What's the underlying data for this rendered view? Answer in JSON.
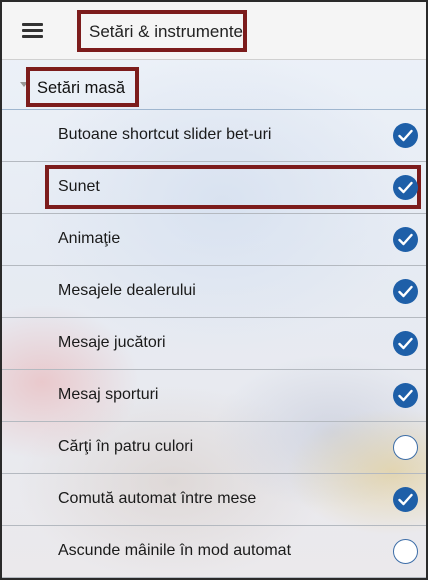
{
  "header": {
    "menu_icon": "hamburger-menu-icon",
    "title": "Setări & instrumente"
  },
  "section": {
    "title": "Setări masă"
  },
  "colors": {
    "accent": "#1e5fa8",
    "highlight_border": "#7c1c1c"
  },
  "settings": [
    {
      "label": "Butoane shortcut slider bet-uri",
      "checked": true
    },
    {
      "label": "Sunet",
      "checked": true
    },
    {
      "label": "Animaţie",
      "checked": true
    },
    {
      "label": "Mesajele dealerului",
      "checked": true
    },
    {
      "label": "Mesaje jucători",
      "checked": true
    },
    {
      "label": "Mesaj sporturi",
      "checked": true
    },
    {
      "label": "Cărţi în patru culori",
      "checked": false
    },
    {
      "label": "Comută automat între mese",
      "checked": true
    },
    {
      "label": "Ascunde mâinile în mod automat",
      "checked": false
    }
  ]
}
